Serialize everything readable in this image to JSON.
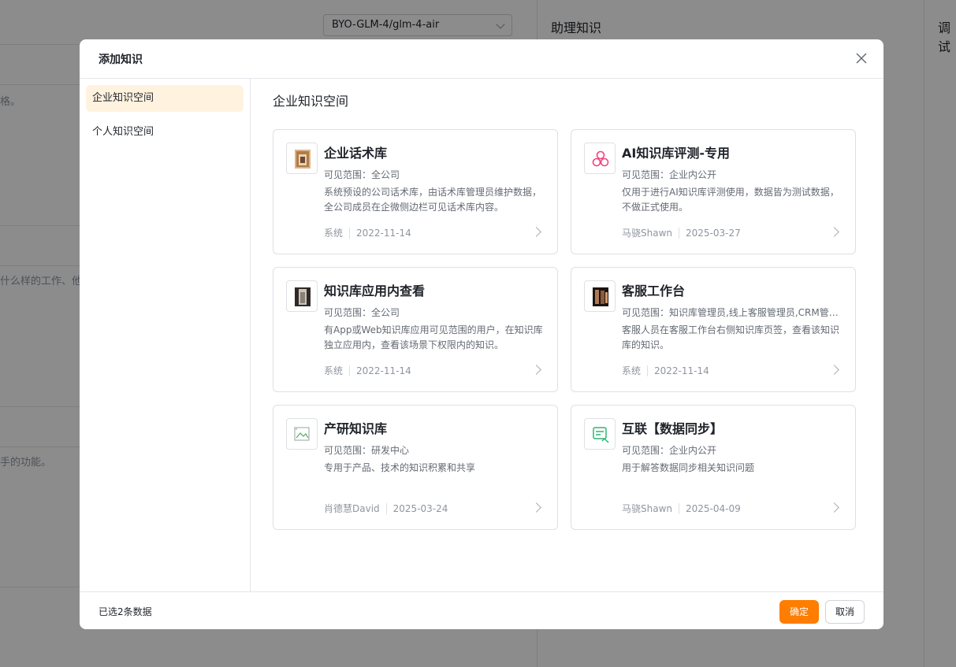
{
  "background": {
    "model_select": "BYO-GLM-4/glm-4-air",
    "middle_title": "助理知识",
    "right_title": "调试",
    "snippets": [
      "格。",
      "什么样的工作、他",
      "手的功能。"
    ]
  },
  "modal": {
    "title": "添加知识",
    "sidebar": {
      "items": [
        {
          "label": "企业知识空间",
          "active": true
        },
        {
          "label": "个人知识空间",
          "active": false
        }
      ]
    },
    "content": {
      "title": "企业知识空间",
      "cards": [
        {
          "name": "企业话术库",
          "scope": "可见范围：全公司",
          "desc": "系统预设的公司话术库，由话术库管理员维护数据，全公司成员在企微侧边栏可见话术库内容。",
          "owner": "系统",
          "date": "2022-11-14",
          "icon": "photo-icon"
        },
        {
          "name": "AI知识库评测-专用",
          "scope": "可见范围：企业内公开",
          "desc": "仅用于进行AI知识库评测使用，数据皆为测试数据，不做正式使用。",
          "owner": "马骁Shawn",
          "date": "2025-03-27",
          "icon": "cluster-icon",
          "icon_color": "#f5417a"
        },
        {
          "name": "知识库应用内查看",
          "scope": "可见范围：全公司",
          "desc": "有App或Web知识库应用可见范围的用户，在知识库独立应用内，查看该场景下权限内的知识。",
          "owner": "系统",
          "date": "2022-11-14",
          "icon": "photo-icon"
        },
        {
          "name": "客服工作台",
          "scope": "可见范围：知识库管理员,线上客服管理员,CRM管理员",
          "desc": "客服人员在客服工作台右侧知识库页签，查看该知识库的知识。",
          "owner": "系统",
          "date": "2022-11-14",
          "icon": "photo-icon"
        },
        {
          "name": "产研知识库",
          "scope": "可见范围：研发中心",
          "desc": "专用于产品、技术的知识积累和共享",
          "owner": "肖德慧David",
          "date": "2025-03-24",
          "icon": "broken-image-icon"
        },
        {
          "name": "互联【数据同步】",
          "scope": "可见范围：企业内公开",
          "desc": "用于解答数据同步相关知识问题",
          "owner": "马骁Shawn",
          "date": "2025-04-09",
          "icon": "sync-doc-icon",
          "icon_color": "#2bb673"
        }
      ]
    },
    "footer": {
      "selected_info": "已选2条数据",
      "confirm_label": "确定",
      "cancel_label": "取消"
    }
  }
}
